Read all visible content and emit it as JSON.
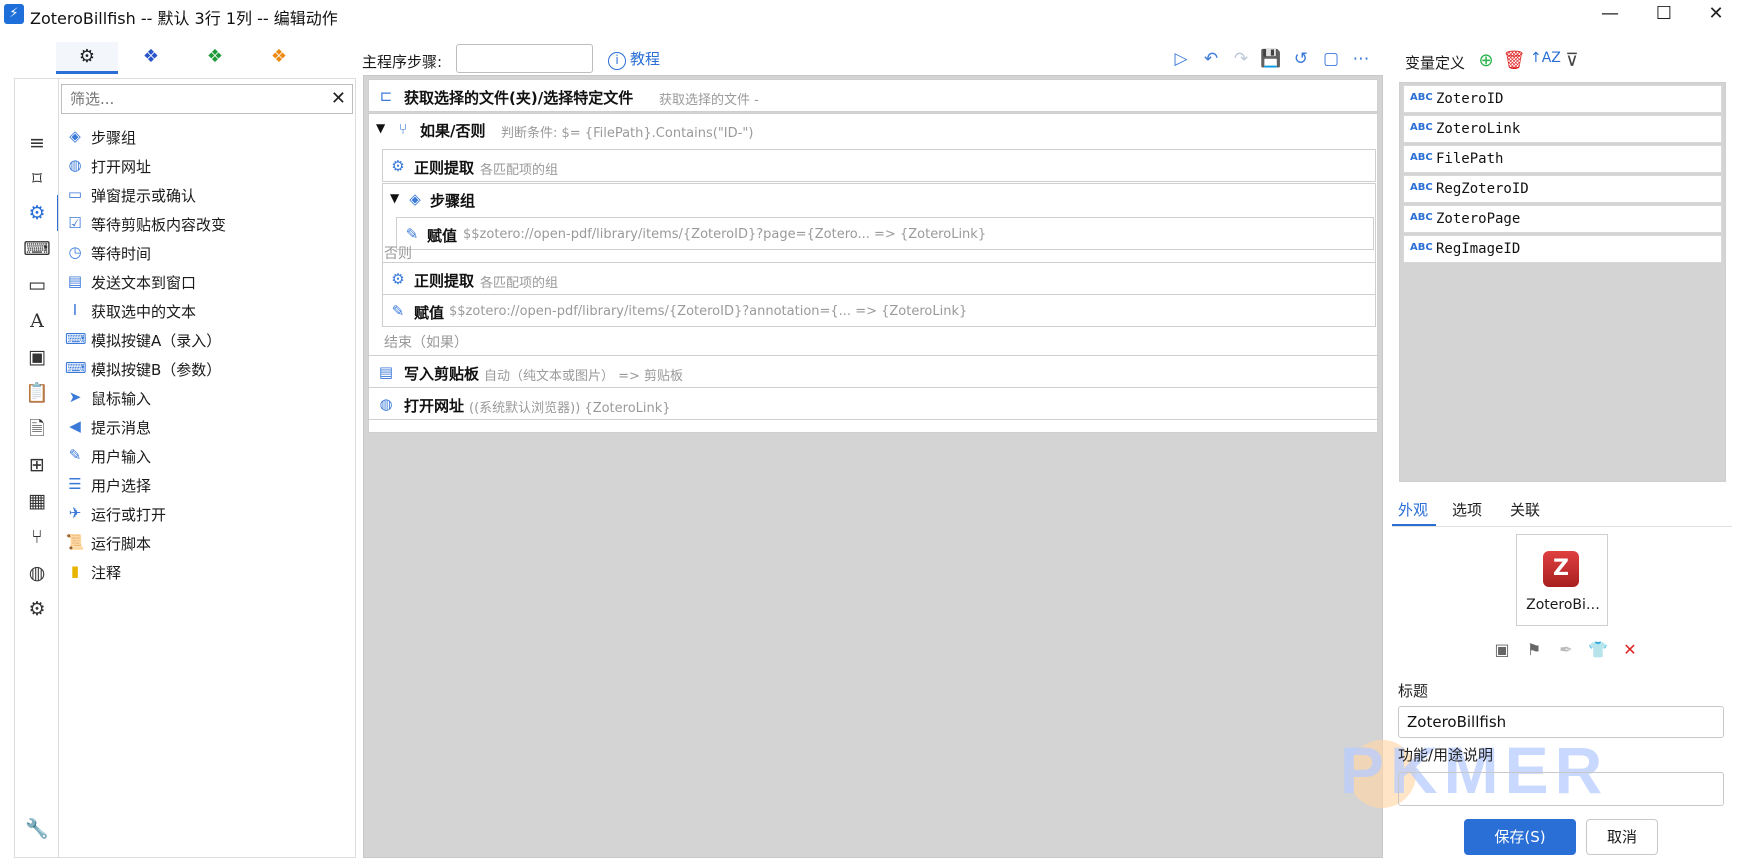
{
  "window": {
    "title": "ZoteroBillfish -- 默认 3行 1列 -- 编辑动作",
    "minimize": "—",
    "maximize": "☐",
    "close": "✕"
  },
  "category_tabs": [
    "gear-cluster",
    "cube-blue",
    "cube-green",
    "cube-orange"
  ],
  "filter": {
    "placeholder": "筛选..."
  },
  "actions": [
    {
      "label": "步骤组",
      "icon": "layers-icon"
    },
    {
      "label": "打开网址",
      "icon": "globe-icon"
    },
    {
      "label": "弹窗提示或确认",
      "icon": "dialog-icon"
    },
    {
      "label": "等待剪贴板内容改变",
      "icon": "clipboard-check-icon"
    },
    {
      "label": "等待时间",
      "icon": "timer-icon"
    },
    {
      "label": "发送文本到窗口",
      "icon": "message-icon"
    },
    {
      "label": "获取选中的文本",
      "icon": "text-cursor-icon"
    },
    {
      "label": "模拟按键A（录入）",
      "icon": "keyboard-icon"
    },
    {
      "label": "模拟按键B（参数）",
      "icon": "keyboard-icon"
    },
    {
      "label": "鼠标输入",
      "icon": "mouse-pointer-icon"
    },
    {
      "label": "提示消息",
      "icon": "megaphone-icon"
    },
    {
      "label": "用户输入",
      "icon": "user-edit-icon"
    },
    {
      "label": "用户选择",
      "icon": "list-check-icon"
    },
    {
      "label": "运行或打开",
      "icon": "send-icon"
    },
    {
      "label": "运行脚本",
      "icon": "script-icon"
    },
    {
      "label": "注释",
      "icon": "note-icon"
    }
  ],
  "toolbar": {
    "steps_label": "主程序步骤:",
    "steps_value": "",
    "tutorial": "教程"
  },
  "steps": {
    "s1_name": "获取选择的文件(夹)/选择特定文件",
    "s1_desc": "获取选择的文件 -",
    "s2_name": "如果/否则",
    "s2_desc": "判断条件: $= {FilePath}.Contains(\"ID-\")",
    "s3_name": "正则提取",
    "s3_desc": "各匹配项的组",
    "s4_name": "步骤组",
    "s5_name": "赋值",
    "s5_desc": "$$zotero://open-pdf/library/items/{ZoteroID}?page={Zotero... => {ZoteroLink}",
    "else_label": "否则",
    "s6_name": "正则提取",
    "s6_desc": "各匹配项的组",
    "s7_name": "赋值",
    "s7_desc": "$$zotero://open-pdf/library/items/{ZoteroID}?annotation={... => {ZoteroLink}",
    "end_label": "结束（如果）",
    "s8_name": "写入剪贴板",
    "s8_desc": "自动（纯文本或图片） => 剪贴板",
    "s9_name": "打开网址",
    "s9_desc": "((系统默认浏览器)) {ZoteroLink}"
  },
  "variables": {
    "header": "变量定义",
    "type_label": "ABC",
    "items": [
      "ZoteroID",
      "ZoteroLink",
      "FilePath",
      "RegZoteroID",
      "ZoteroPage",
      "RegImageID"
    ]
  },
  "right_tabs": [
    "外观",
    "选项",
    "关联"
  ],
  "appearance": {
    "preview_name": "ZoteroBi…",
    "title_label": "标题",
    "title_value": "ZoteroBillfish",
    "desc_label": "功能/用途说明",
    "desc_value": ""
  },
  "buttons": {
    "save": "保存(S)",
    "cancel": "取消"
  },
  "watermark": "PKMER",
  "colors": {
    "accent": "#2a6fd6",
    "add": "#2bb24c",
    "delete": "#e02424"
  }
}
